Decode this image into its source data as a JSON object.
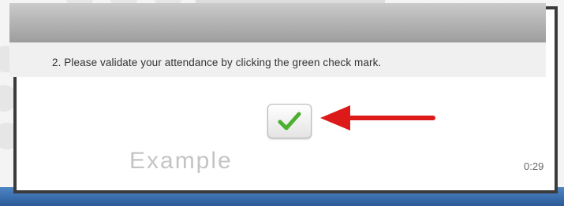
{
  "dialog": {
    "instruction": "2. Please validate your attendance by clicking the green check mark.",
    "watermark": "Example",
    "timer": "0:29"
  },
  "colors": {
    "check": "#4caf2f",
    "arrow": "#dd1a1a",
    "frame": "#3b3b3b",
    "taskbar": "#2a5a98"
  },
  "icons": {
    "check_button": "check-icon",
    "pointer": "red-arrow"
  }
}
